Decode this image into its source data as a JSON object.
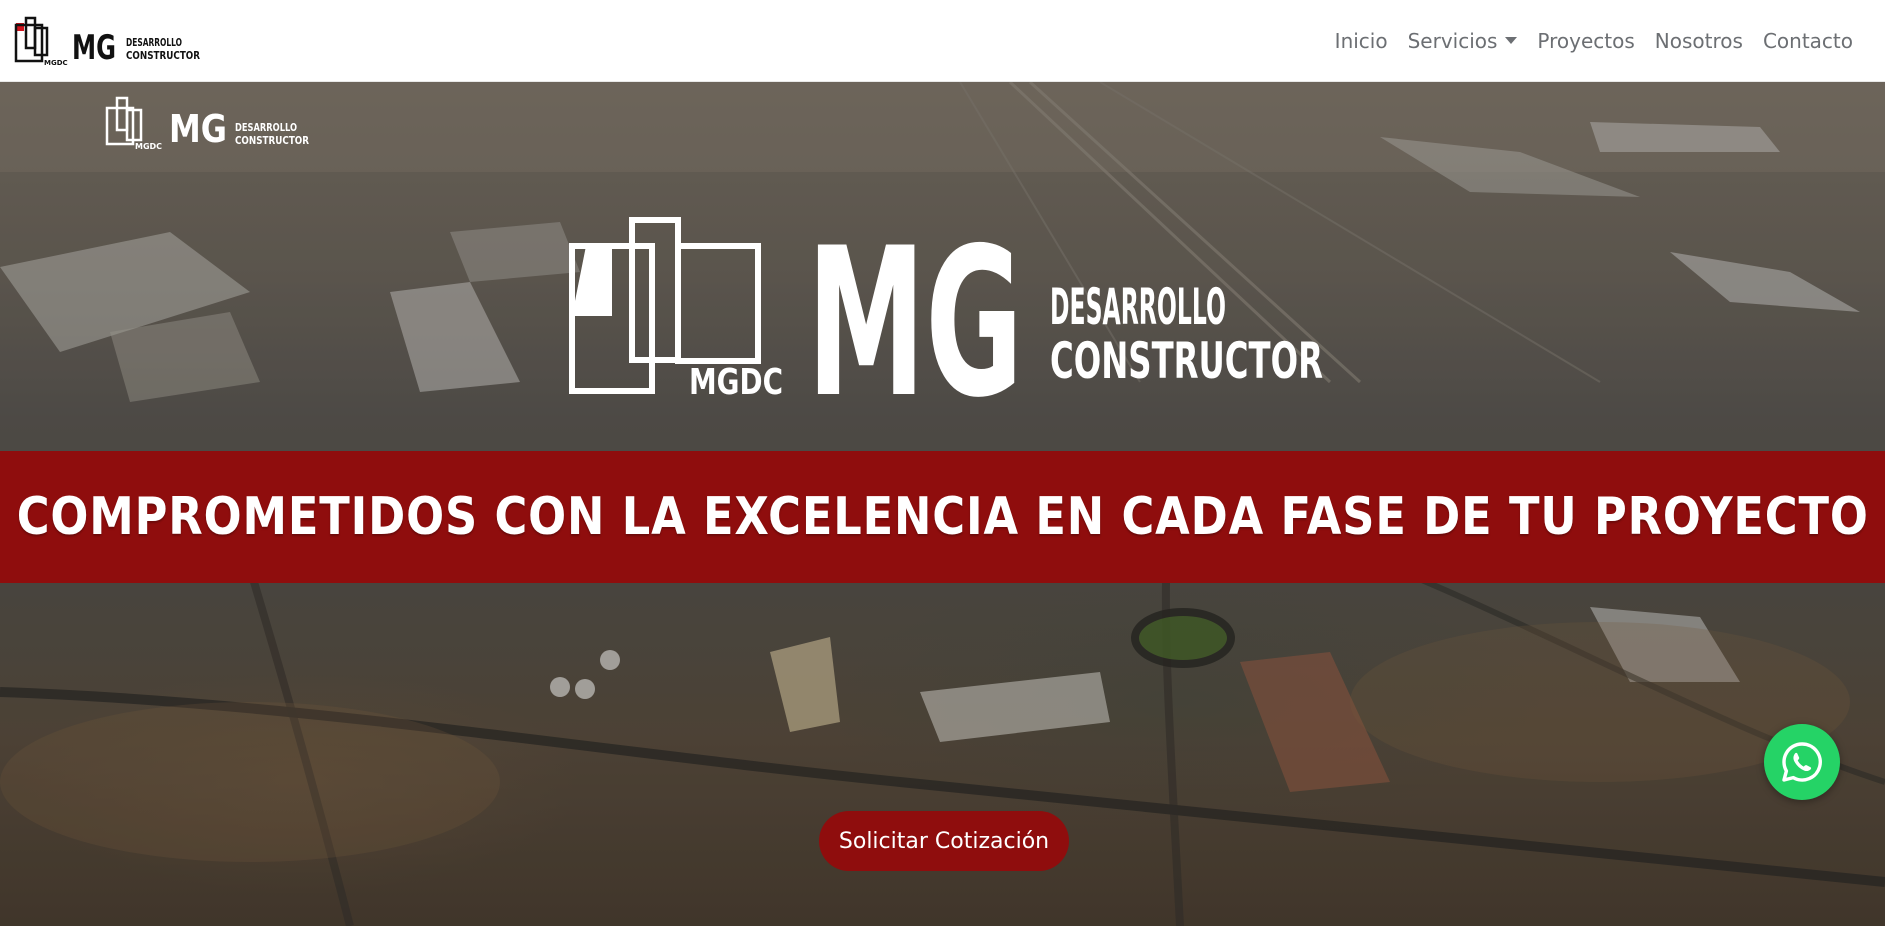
{
  "nav": {
    "brand": {
      "mark": "MGDC",
      "initials": "MG",
      "line1": "DESARROLLO",
      "line2": "CONSTRUCTOR"
    },
    "links": [
      {
        "label": "Inicio",
        "dropdown": false
      },
      {
        "label": "Servicios",
        "dropdown": true
      },
      {
        "label": "Proyectos",
        "dropdown": false
      },
      {
        "label": "Nosotros",
        "dropdown": false
      },
      {
        "label": "Contacto",
        "dropdown": false
      }
    ]
  },
  "hero": {
    "small_logo": {
      "mark": "MGDC",
      "initials": "MG",
      "line1": "DESARROLLO",
      "line2": "CONSTRUCTOR"
    },
    "big_logo": {
      "mark": "MGDC",
      "initials": "MG",
      "line1": "DESARROLLO",
      "line2": "CONSTRUCTOR"
    },
    "banner_text": "COMPROMETIDOS CON LA EXCELENCIA EN CADA FASE DE TU PROYECTO",
    "cta_label": "Solicitar Cotización"
  },
  "floating": {
    "icon": "whatsapp-icon"
  },
  "colors": {
    "accent": "#8f0d0d",
    "whatsapp": "#25d366",
    "nav_text": "#6c6f73",
    "logo_red": "#d0121b"
  }
}
